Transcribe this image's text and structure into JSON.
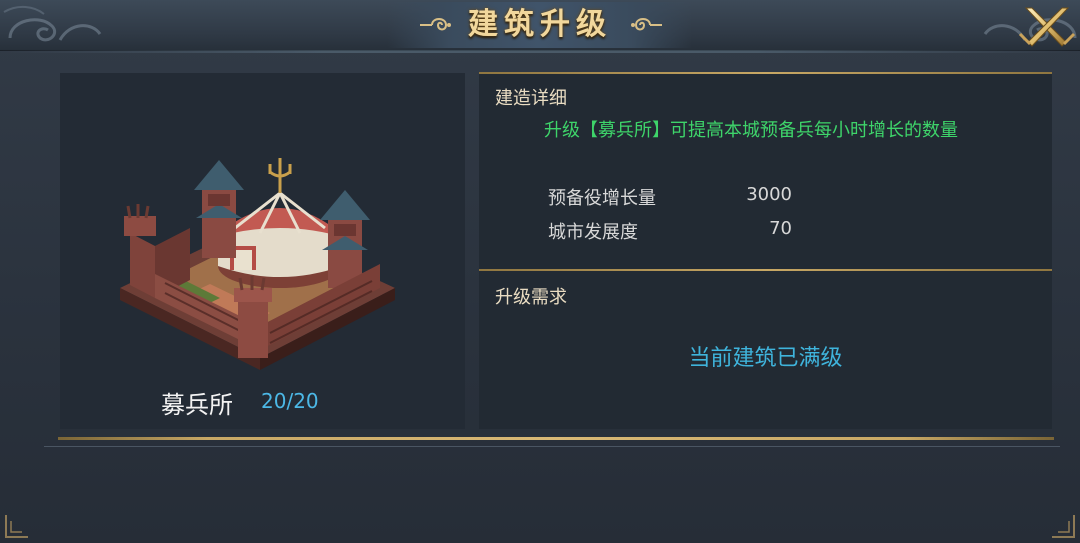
{
  "window": {
    "title": "建筑升级"
  },
  "building": {
    "name": "募兵所",
    "level": "20/20"
  },
  "details": {
    "heading": "建造详细",
    "description": "升级【募兵所】可提高本城预备兵每小时增长的数量",
    "stats": [
      {
        "label": "预备役增长量",
        "value": "3000"
      },
      {
        "label": "城市发展度",
        "value": "70"
      }
    ]
  },
  "requirements": {
    "heading": "升级需求",
    "status": "当前建筑已满级"
  },
  "colors": {
    "title_gold": "#f1d79c",
    "description_green": "#3ed46a",
    "level_blue": "#4cb8e6",
    "status_blue": "#3fb4dc",
    "frame_gold": "#c8a865"
  },
  "icons": {
    "close": "crossed-swords-close-icon",
    "title_left": "scroll-ornament-icon",
    "title_right": "scroll-ornament-icon"
  }
}
